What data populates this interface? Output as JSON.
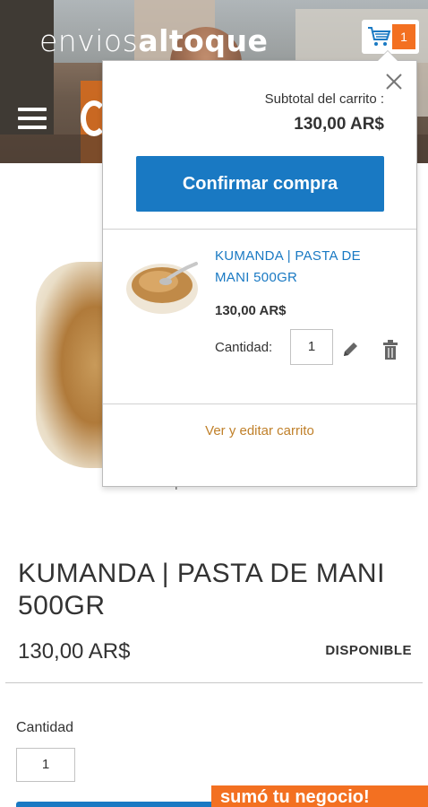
{
  "header": {
    "logo_light": "envios",
    "logo_bold": "altoque",
    "cart_count": "1",
    "cart_icon": "shopping-cart-icon",
    "menu_icon": "hamburger-menu-icon"
  },
  "product": {
    "image_caption": "KUMANDA | PASTA DE MANI 500GR",
    "title": "KUMANDA | PASTA DE MANI 500GR",
    "price": "130,00 AR$",
    "availability": "DISPONIBLE",
    "quantity_label": "Cantidad",
    "quantity_value": "1"
  },
  "minicart": {
    "subtotal_label": "Subtotal del carrito :",
    "subtotal_value": "130,00 AR$",
    "confirm_label": "Confirmar compra",
    "item": {
      "name": "KUMANDA | PASTA DE MANI 500GR",
      "price": "130,00 AR$",
      "qty_label": "Cantidad:",
      "qty_value": "1"
    },
    "view_edit_label": "Ver y editar carrito"
  },
  "promo": {
    "text": "sumó tu negocio!"
  },
  "colors": {
    "primary": "#1979c3",
    "accent": "#f37021",
    "link_orange": "#c0802a"
  }
}
